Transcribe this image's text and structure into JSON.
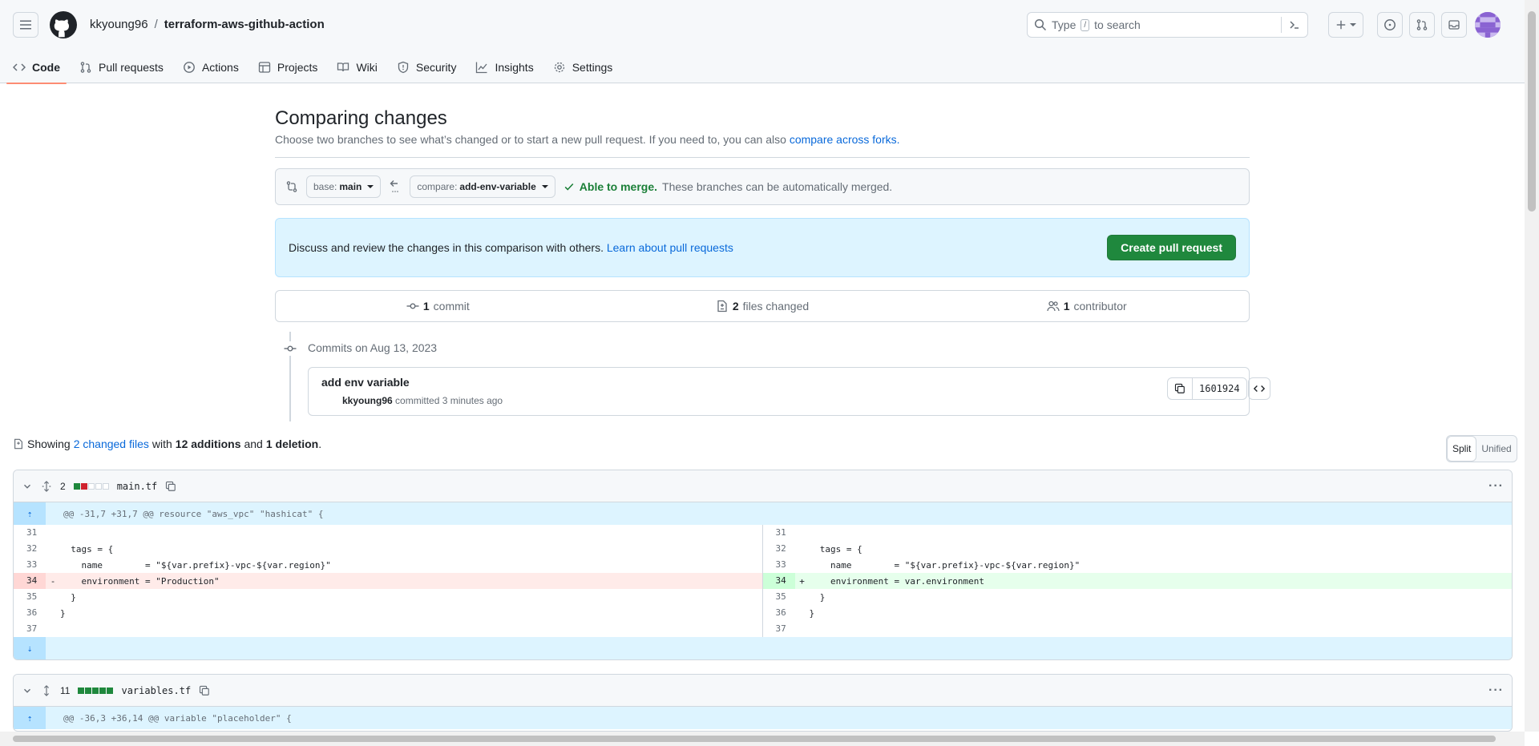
{
  "header": {
    "owner": "kkyoung96",
    "separator": "/",
    "repo": "terraform-aws-github-action",
    "search_placeholder_pre": "Type",
    "search_key": "/",
    "search_placeholder_post": "to search"
  },
  "nav": [
    {
      "label": "Code",
      "icon": "code-icon",
      "active": true
    },
    {
      "label": "Pull requests",
      "icon": "pull-request-icon"
    },
    {
      "label": "Actions",
      "icon": "play-icon"
    },
    {
      "label": "Projects",
      "icon": "table-icon"
    },
    {
      "label": "Wiki",
      "icon": "book-icon"
    },
    {
      "label": "Security",
      "icon": "shield-icon"
    },
    {
      "label": "Insights",
      "icon": "graph-icon"
    },
    {
      "label": "Settings",
      "icon": "gear-icon"
    }
  ],
  "compare": {
    "title": "Comparing changes",
    "subtitle": "Choose two branches to see what’s changed or to start a new pull request. If you need to, you can also",
    "subtitle_link": "compare across forks.",
    "base_label": "base:",
    "base_value": "main",
    "compare_label": "compare:",
    "compare_value": "add-env-variable",
    "merge_status": "Able to merge.",
    "merge_text": "These branches can be automatically merged."
  },
  "flash": {
    "text": "Discuss and review the changes in this comparison with others.",
    "link": "Learn about pull requests",
    "button": "Create pull request"
  },
  "stats": {
    "commits_count": "1",
    "commits_label": "commit",
    "files_count": "2",
    "files_label": "files changed",
    "contributors_count": "1",
    "contributors_label": "contributor"
  },
  "commits": {
    "date_heading": "Commits on Aug 13, 2023",
    "message": "add env variable",
    "author": "kkyoung96",
    "meta": "committed 3 minutes ago",
    "sha": "1601924"
  },
  "summary": {
    "showing": "Showing",
    "changed_files": "2 changed files",
    "with": "with",
    "additions": "12 additions",
    "and": "and",
    "deletions": "1 deletion",
    "end": ".",
    "split": "Split",
    "unified": "Unified"
  },
  "files": [
    {
      "count": "2",
      "name": "main.tf",
      "hunk": "@@ -31,7 +31,7 @@ resource \"aws_vpc\" \"hashicat\" {",
      "left": [
        {
          "ln": "31",
          "mk": "",
          "code": ""
        },
        {
          "ln": "32",
          "mk": "",
          "code": "  tags = {"
        },
        {
          "ln": "33",
          "mk": "",
          "code": "    name        = \"${var.prefix}-vpc-${var.region}\""
        },
        {
          "ln": "34",
          "mk": "-",
          "code": "    environment = \"Production\"",
          "type": "del"
        },
        {
          "ln": "35",
          "mk": "",
          "code": "  }"
        },
        {
          "ln": "36",
          "mk": "",
          "code": "}"
        },
        {
          "ln": "37",
          "mk": "",
          "code": ""
        }
      ],
      "right": [
        {
          "ln": "31",
          "mk": "",
          "code": ""
        },
        {
          "ln": "32",
          "mk": "",
          "code": "  tags = {"
        },
        {
          "ln": "33",
          "mk": "",
          "code": "    name        = \"${var.prefix}-vpc-${var.region}\""
        },
        {
          "ln": "34",
          "mk": "+",
          "code": "    environment = var.environment",
          "type": "add"
        },
        {
          "ln": "35",
          "mk": "",
          "code": "  }"
        },
        {
          "ln": "36",
          "mk": "",
          "code": "}"
        },
        {
          "ln": "37",
          "mk": "",
          "code": ""
        }
      ]
    },
    {
      "count": "11",
      "name": "variables.tf",
      "hunk": "@@ -36,3 +36,14 @@ variable \"placeholder\" {"
    }
  ]
}
